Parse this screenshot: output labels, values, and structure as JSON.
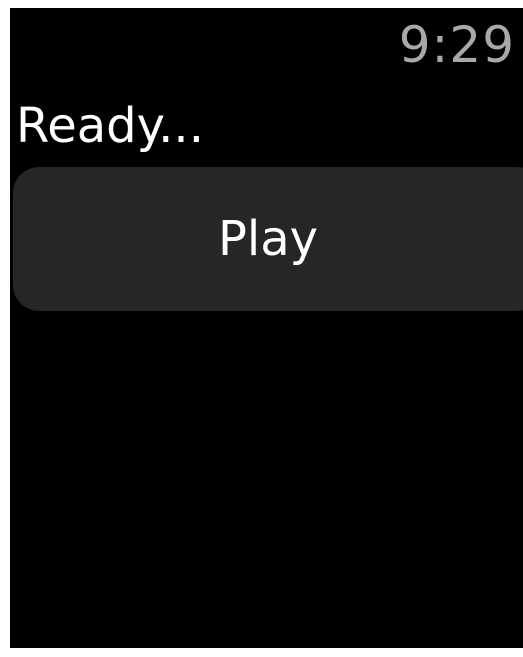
{
  "status_bar": {
    "time": "9:29"
  },
  "main": {
    "status_text": "Ready...",
    "play_button_label": "Play"
  },
  "colors": {
    "background": "#000000",
    "button_background": "#262626",
    "clock_text": "#a8a8a8",
    "primary_text": "#ffffff"
  }
}
